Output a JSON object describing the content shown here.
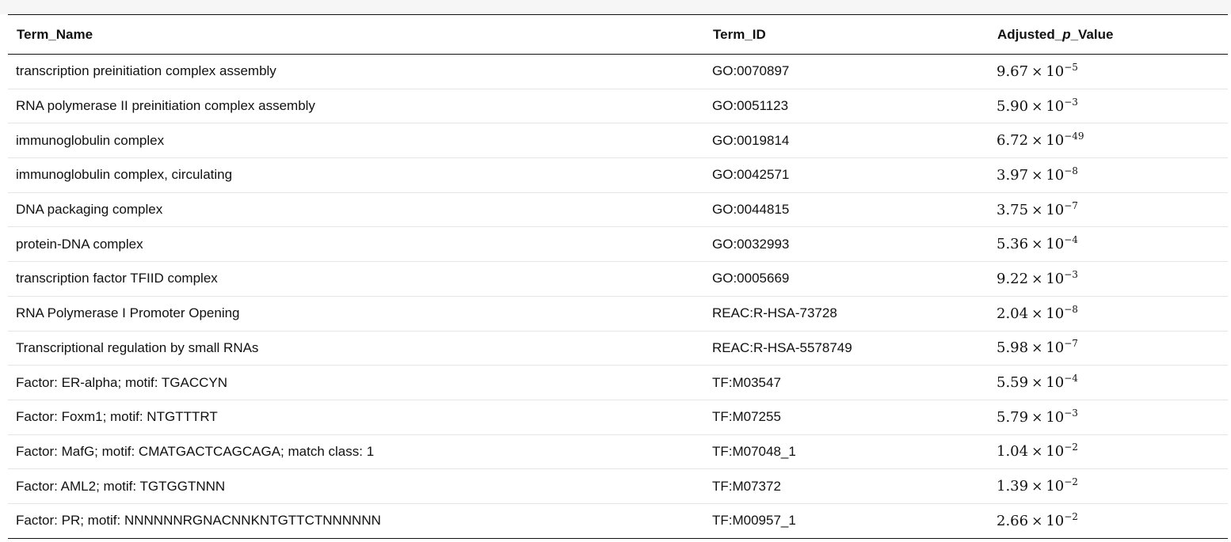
{
  "table": {
    "headers": {
      "term_name": "Term_Name",
      "term_id": "Term_ID",
      "adj_prefix": "Adjusted_",
      "adj_p": "p",
      "adj_suffix": "_Value"
    },
    "times_symbol": "×",
    "rows": [
      {
        "name": "transcription preinitiation complex assembly",
        "id": "GO:0070897",
        "mantissa": "9.67",
        "base": "10",
        "exp": "−5"
      },
      {
        "name": "RNA polymerase II preinitiation complex assembly",
        "id": "GO:0051123",
        "mantissa": "5.90",
        "base": "10",
        "exp": "−3"
      },
      {
        "name": "immunoglobulin complex",
        "id": "GO:0019814",
        "mantissa": "6.72",
        "base": "10",
        "exp": "−49"
      },
      {
        "name": "immunoglobulin complex, circulating",
        "id": "GO:0042571",
        "mantissa": "3.97",
        "base": "10",
        "exp": "−8"
      },
      {
        "name": "DNA packaging complex",
        "id": "GO:0044815",
        "mantissa": "3.75",
        "base": "10",
        "exp": "−7"
      },
      {
        "name": "protein-DNA complex",
        "id": "GO:0032993",
        "mantissa": "5.36",
        "base": "10",
        "exp": "−4"
      },
      {
        "name": "transcription factor TFIID complex",
        "id": "GO:0005669",
        "mantissa": "9.22",
        "base": "10",
        "exp": "−3"
      },
      {
        "name": "RNA Polymerase I Promoter Opening",
        "id": "REAC:R-HSA-73728",
        "mantissa": "2.04",
        "base": "10",
        "exp": "−8"
      },
      {
        "name": "Transcriptional regulation by small RNAs",
        "id": "REAC:R-HSA-5578749",
        "mantissa": "5.98",
        "base": "10",
        "exp": "−7"
      },
      {
        "name": "Factor: ER-alpha; motif: TGACCYN",
        "id": "TF:M03547",
        "mantissa": "5.59",
        "base": "10",
        "exp": "−4"
      },
      {
        "name": "Factor: Foxm1; motif: NTGTTTRT",
        "id": "TF:M07255",
        "mantissa": "5.79",
        "base": "10",
        "exp": "−3"
      },
      {
        "name": "Factor: MafG; motif: CMATGACTCAGCAGA; match class: 1",
        "id": "TF:M07048_1",
        "mantissa": "1.04",
        "base": "10",
        "exp": "−2"
      },
      {
        "name": "Factor: AML2; motif: TGTGGTNNN",
        "id": "TF:M07372",
        "mantissa": "1.39",
        "base": "10",
        "exp": "−2"
      },
      {
        "name": "Factor: PR; motif: NNNNNNRGNACNNKNTGTTCTNNNNNN",
        "id": "TF:M00957_1",
        "mantissa": "2.66",
        "base": "10",
        "exp": "−2"
      }
    ]
  }
}
